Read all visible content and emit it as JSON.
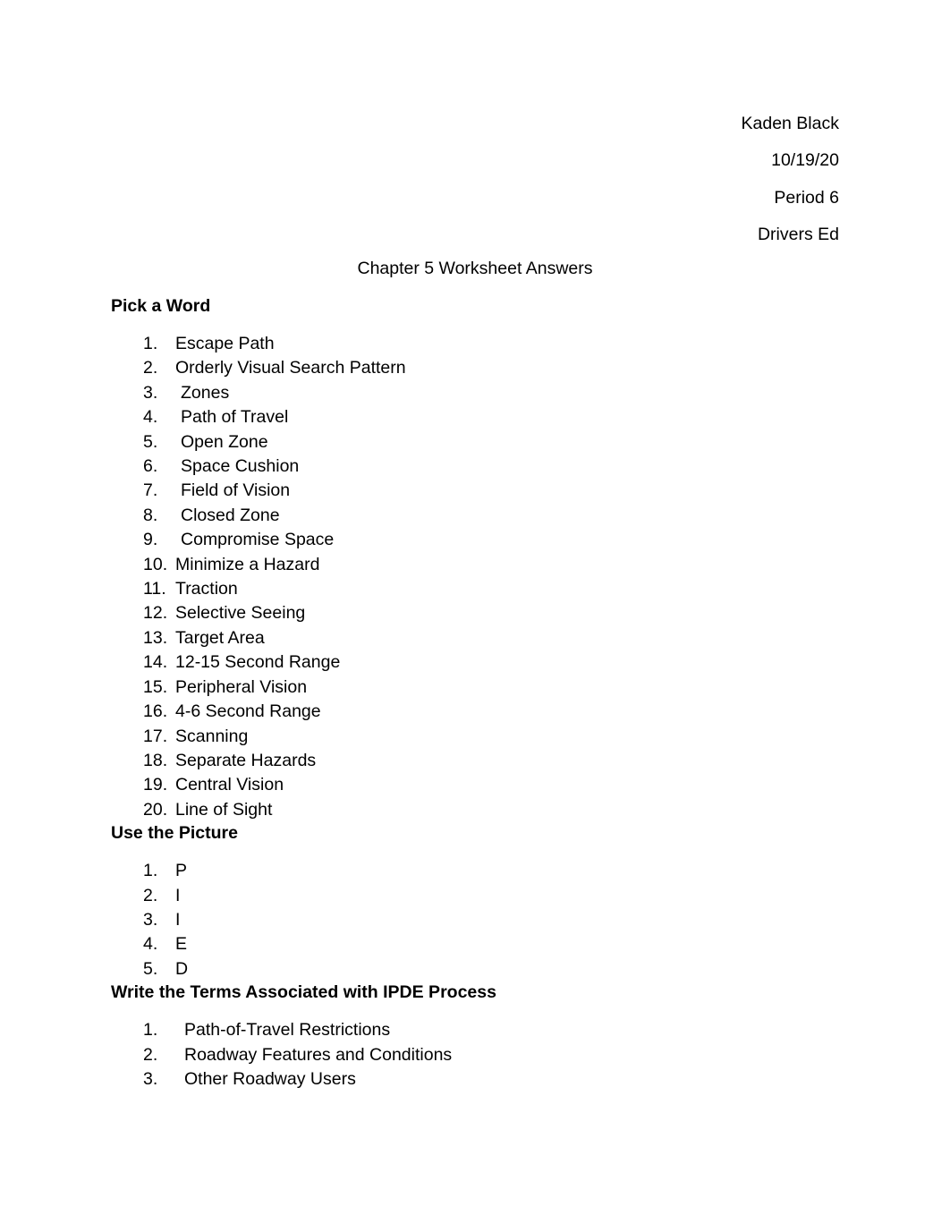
{
  "document": {
    "header_lines": [
      "Kaden Black",
      "10/19/20",
      "Period 6",
      "Drivers Ed"
    ],
    "title": "Chapter 5 Worksheet Answers"
  },
  "sections": [
    {
      "heading": "Pick a Word",
      "items": [
        "Escape Path",
        "Orderly Visual Search Pattern",
        "Zones",
        "Path of Travel",
        "Open Zone",
        "Space Cushion",
        "Field of Vision",
        "Closed Zone",
        "Compromise Space",
        "Minimize a Hazard",
        "Traction",
        "Selective Seeing",
        "Target Area",
        "12-15 Second Range",
        "Peripheral Vision",
        "4-6 Second Range",
        "Scanning",
        "Separate Hazards",
        "Central Vision",
        "Line of Sight"
      ],
      "numbers": [
        "1.",
        "2.",
        "3.",
        "4.",
        "5.",
        "6.",
        "7.",
        "8.",
        "9.",
        "10.",
        "11.",
        "12.",
        "13.",
        "14.",
        "15.",
        "16.",
        "17.",
        "18.",
        "19.",
        "20."
      ]
    },
    {
      "heading": "Use the Picture",
      "items": [
        "P",
        "I",
        "I",
        "E",
        "D"
      ],
      "numbers": [
        "1.",
        "2.",
        "3.",
        "4.",
        "5."
      ]
    },
    {
      "heading": "Write the Terms Associated with IPDE Process",
      "items": [
        "Path-of-Travel Restrictions",
        "Roadway Features and Conditions",
        "Other Roadway Users"
      ],
      "numbers": [
        "1.",
        "2.",
        "3."
      ]
    }
  ]
}
